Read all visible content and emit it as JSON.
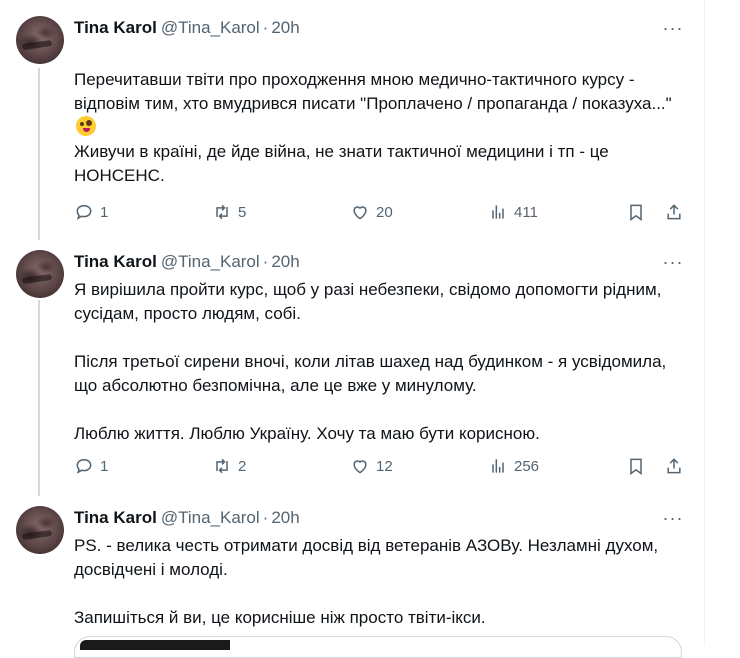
{
  "tweets": [
    {
      "name": "Tina Karol",
      "handle": "@Tina_Karol",
      "separator": "·",
      "time": "20h",
      "more": "···",
      "text_a": "Перечитавши твіти про проходження мною медично-тактичного курсу - відповім тим, хто вмудрився писати \"Проплачено / пропаганда / показуха...\"",
      "emoji": "zany-face-emoji",
      "text_b": "Живучи в країні, де йде війна, не знати тактичної медицини і тп  - це НОНСЕНС.",
      "replies": "1",
      "retweets": "5",
      "likes": "20",
      "views": "411"
    },
    {
      "name": "Tina Karol",
      "handle": "@Tina_Karol",
      "separator": "·",
      "time": "20h",
      "more": "···",
      "text": "Я вирішила пройти курс, щоб у разі небезпеки, свідомо допомогти рідним, сусідам, просто людям, собі.\n\nПісля третьої сирени вночі, коли літав шахед над будинком - я усвідомила, що абсолютно безпомічна, але це вже у минулому.\n\nЛюблю життя. Люблю Україну. Хочу та маю бути корисною.",
      "replies": "1",
      "retweets": "2",
      "likes": "12",
      "views": "256"
    },
    {
      "name": "Tina Karol",
      "handle": "@Tina_Karol",
      "separator": "·",
      "time": "20h",
      "more": "···",
      "text": "PS. - велика честь отримати досвід від ветеранів АЗОВу. Незламні духом, досвідчені і молоді.\n\nЗапишіться й ви, це корисніше ніж просто твіти-ікси."
    }
  ],
  "icons": {
    "reply": "reply-icon",
    "retweet": "retweet-icon",
    "like": "heart-icon",
    "views": "views-chart-icon",
    "bookmark": "bookmark-icon",
    "share": "share-icon"
  },
  "colors": {
    "text": "#0f1419",
    "secondary": "#536471",
    "thread_line": "#cfd9de"
  }
}
